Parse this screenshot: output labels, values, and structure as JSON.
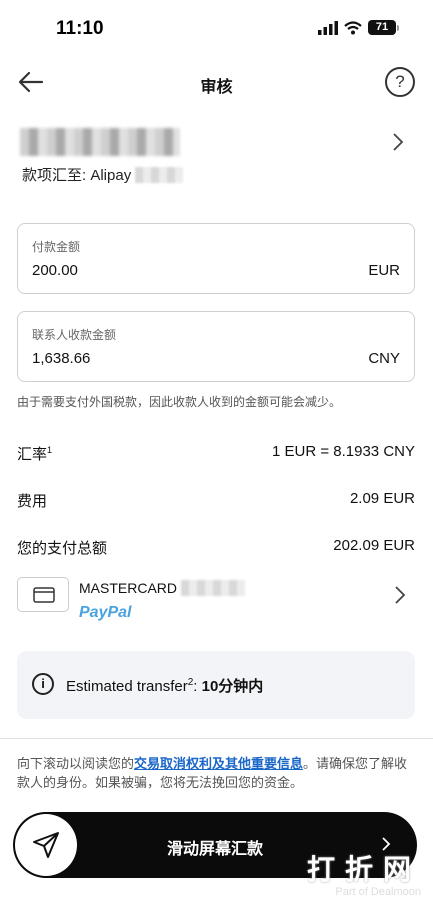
{
  "status_bar": {
    "time": "11:10",
    "battery": "71"
  },
  "nav": {
    "title": "审核"
  },
  "recipient": {
    "transfer_to_label": "款项汇至: Alipay"
  },
  "payment_amount": {
    "label": "付款金额",
    "value": "200.00",
    "currency": "EUR"
  },
  "recipient_amount": {
    "label": "联系人收款金额",
    "value": "1,638.66",
    "currency": "CNY"
  },
  "tax_note": "由于需要支付外国税款，因此收款人收到的金额可能会减少。",
  "rows": {
    "exchange_rate": {
      "label": "汇率",
      "footnote": "1",
      "value": "1 EUR = 8.1933 CNY"
    },
    "fee": {
      "label": "费用",
      "value": "2.09 EUR"
    },
    "total": {
      "label": "您的支付总额",
      "value": "202.09 EUR"
    }
  },
  "card": {
    "name": "MASTERCARD",
    "provider": "PayPal"
  },
  "estimate": {
    "label": "Estimated transfer",
    "footnote": "2",
    "value": "10分钟内"
  },
  "legal": {
    "prefix": "向下滚动以阅读您的",
    "link": "交易取消权利及其他重要信息",
    "suffix": "。请确保您了解收款人的身份。如果被骗，您将无法挽回您的资金。"
  },
  "slider": {
    "label": "滑动屏幕汇款"
  },
  "watermark": {
    "main": "打折网",
    "sub": "Part of Dealmoon"
  }
}
